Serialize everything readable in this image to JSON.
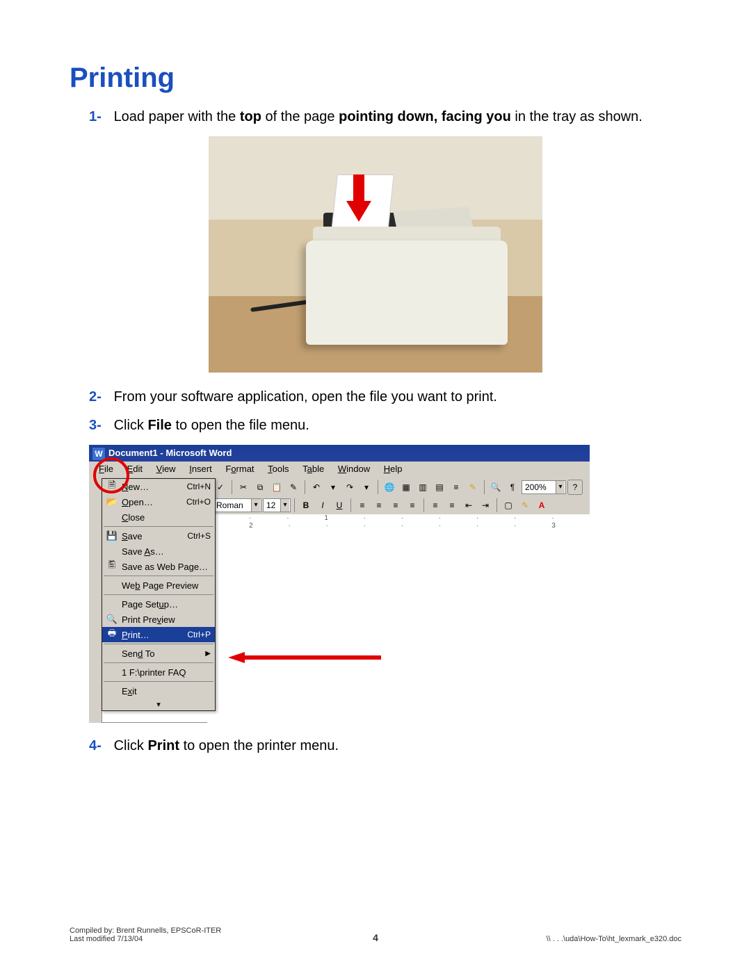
{
  "title": "Printing",
  "steps": {
    "s1_num": "1-",
    "s1_a": "Load paper with the ",
    "s1_b": "top",
    "s1_c": " of the page ",
    "s1_d": "pointing down, facing you",
    "s1_e": " in the tray as shown.",
    "s2_num": "2-",
    "s2": "From your software application, open the file you want to print.",
    "s3_num": "3-",
    "s3_a": "Click ",
    "s3_b": "File",
    "s3_c": " to open the file menu.",
    "s4_num": "4-",
    "s4_a": "Click ",
    "s4_b": "Print",
    "s4_c": " to open the printer menu."
  },
  "word": {
    "title": "Document1 - Microsoft Word",
    "icon": "W",
    "menu": {
      "file": "File",
      "edit": "Edit",
      "view": "View",
      "insert": "Insert",
      "format": "Format",
      "tools": "Tools",
      "table": "Table",
      "window": "Window",
      "help": "Help"
    },
    "toolbar": {
      "font": "Roman",
      "size": "12",
      "zoom": "200%"
    },
    "ruler": "· · · 1 · · · · · · · 2 · · · · · · · 3 ·",
    "filemenu": {
      "new": "New…",
      "new_sc": "Ctrl+N",
      "open": "Open…",
      "open_sc": "Ctrl+O",
      "close": "Close",
      "save": "Save",
      "save_sc": "Ctrl+S",
      "saveas": "Save As…",
      "saveweb": "Save as Web Page…",
      "webprev": "Web Page Preview",
      "pagesetup": "Page Setup…",
      "printprev": "Print Preview",
      "print": "Print…",
      "print_sc": "Ctrl+P",
      "sendto": "Send To",
      "recent": "1 F:\\printer FAQ",
      "exit": "Exit",
      "expand": "▾"
    }
  },
  "footer": {
    "left1": "Compiled by: Brent Runnells,  EPSCoR-ITER",
    "left2": "Last modified 7/13/04",
    "page": "4",
    "right": "\\\\ . . .\\uda\\How-To\\ht_lexmark_e320.doc"
  }
}
